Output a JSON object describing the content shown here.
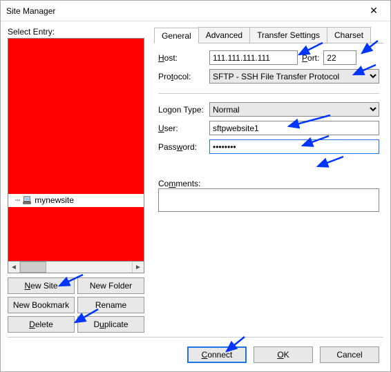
{
  "window": {
    "title": "Site Manager"
  },
  "left": {
    "select_entry_label": "Select Entry:",
    "site_name": "mynewsite",
    "buttons": {
      "new_site": "New Site",
      "new_folder": "New Folder",
      "new_bookmark": "New Bookmark",
      "rename": "Rename",
      "delete": "Delete",
      "duplicate": "Duplicate"
    }
  },
  "tabs": {
    "general": "General",
    "advanced": "Advanced",
    "transfer": "Transfer Settings",
    "charset": "Charset"
  },
  "form": {
    "host_label": "Host:",
    "host_value": "111.111.111.111",
    "port_label": "Port:",
    "port_value": "22",
    "protocol_label": "Protocol:",
    "protocol_value": "SFTP - SSH File Transfer Protocol",
    "logon_type_label": "Logon Type:",
    "logon_type_value": "Normal",
    "user_label": "User:",
    "user_value": "sftpwebsite1",
    "password_label": "Password:",
    "password_value": "••••••••",
    "comments_label": "Comments:",
    "comments_value": ""
  },
  "footer": {
    "connect": "Connect",
    "ok": "OK",
    "cancel": "Cancel"
  }
}
